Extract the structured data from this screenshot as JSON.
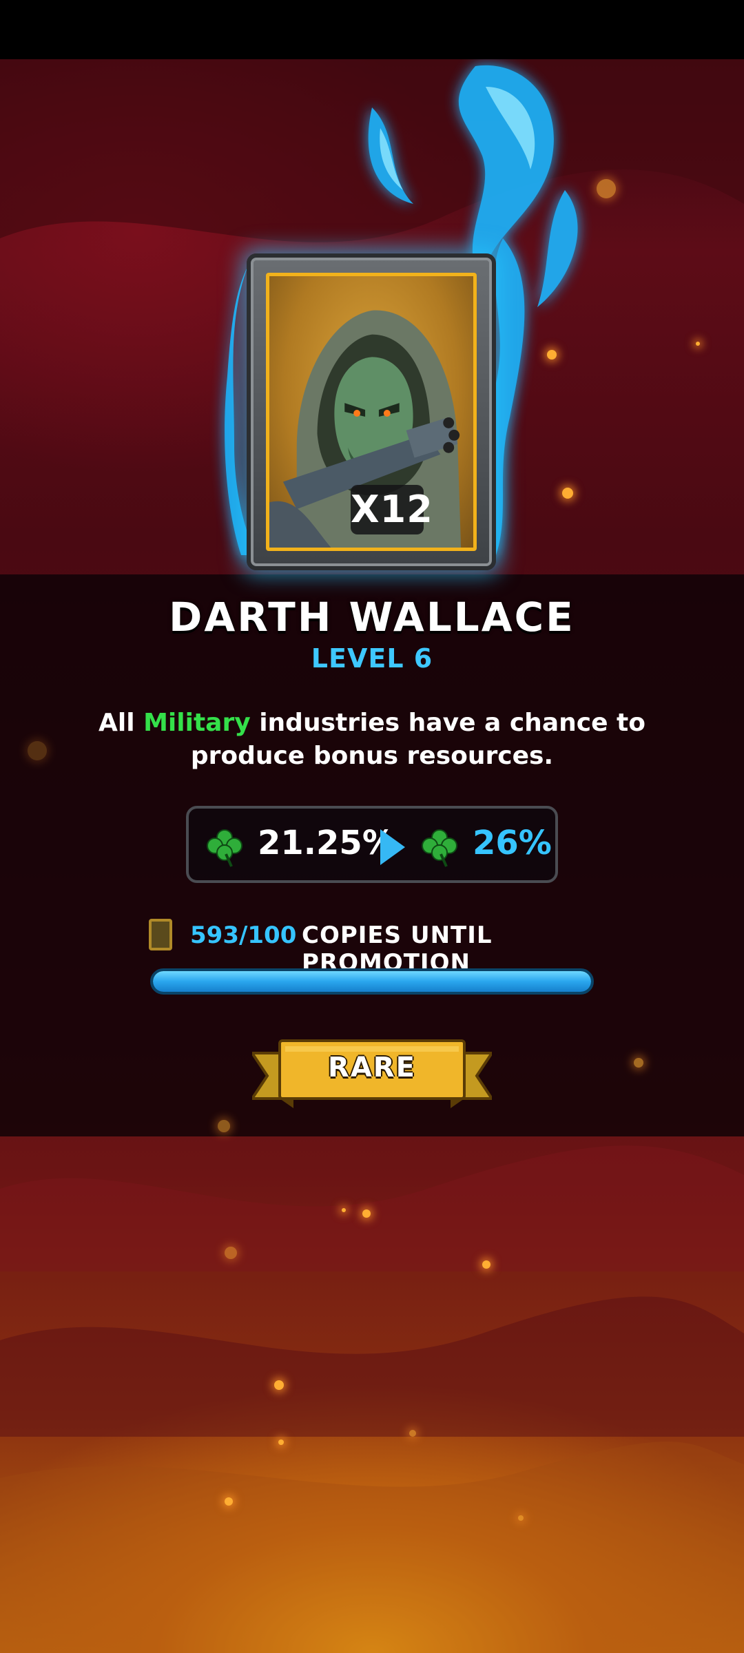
{
  "hero": {
    "name": "DARTH WALLACE",
    "level": "LEVEL 6",
    "card_count": "X12",
    "rarity": "RARE"
  },
  "ability": {
    "prefix": "All ",
    "highlight": "Military",
    "suffix": " industries have a chance to produce bonus resources.",
    "highlight_color": "#34e04a"
  },
  "stats": {
    "current": "21.25%",
    "next": "26%",
    "icon": "clover-icon",
    "arrow_icon": "play-arrow-icon"
  },
  "promotion": {
    "copies": "593/100",
    "label": "COPIES UNTIL PROMOTION",
    "progress": 1.0
  },
  "colors": {
    "accent_blue": "#36c4ff",
    "gold": "#f2b21b",
    "background_red": "#5d0c17"
  }
}
